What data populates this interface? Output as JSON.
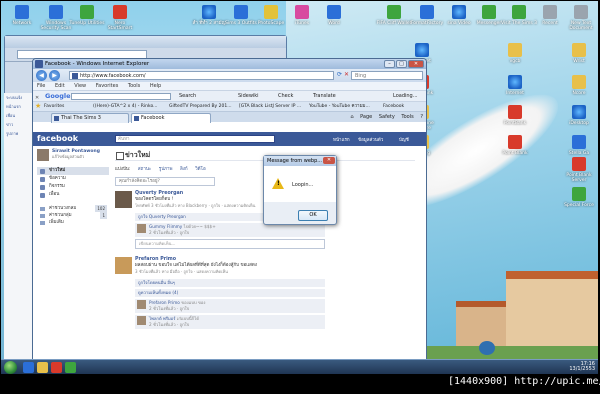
{
  "desktop": {
    "icons_top": [
      {
        "label": "Network",
        "cls": "g-blue"
      },
      {
        "label": "Windows Security Scan",
        "cls": "g-blue"
      },
      {
        "label": "TuneUp Utilities",
        "cls": "g-green"
      },
      {
        "label": "Nero StartSmart",
        "cls": "g-red"
      },
      {
        "label": "สำ ที่ทำ 2 สามัญ",
        "cls": "g-ie"
      },
      {
        "label": "Sims 3 Outfits",
        "cls": "g-blue"
      },
      {
        "label": "PhotoScape",
        "cls": "g-yel"
      },
      {
        "label": "iTunes",
        "cls": "g-pink"
      },
      {
        "label": "Word",
        "cls": "g-blue"
      },
      {
        "label": "FIFA Cliff Wallet",
        "cls": "g-green"
      },
      {
        "label": "FormatFactory",
        "cls": "g-blue"
      },
      {
        "label": "sina Video",
        "cls": "g-ie"
      },
      {
        "label": "Messenger",
        "cls": "g-green"
      },
      {
        "label": "Visit The Sims 3",
        "cls": "g-green"
      },
      {
        "label": "Recent",
        "cls": "g-gray"
      },
      {
        "label": "New Text Document",
        "cls": "g-gray"
      }
    ],
    "icons_right": [
      {
        "label": "Internet",
        "cls": "g-ie"
      },
      {
        "label": "vgcb",
        "cls": "g-fold"
      },
      {
        "label": "Wrist",
        "cls": "g-fold"
      },
      {
        "label": "PointBank",
        "cls": "g-red"
      },
      {
        "label": "Internet",
        "cls": "g-ie"
      },
      {
        "label": "Ncore",
        "cls": "g-fold"
      },
      {
        "label": "Fast Stone Capture",
        "cls": "g-fold"
      },
      {
        "label": "PointBank",
        "cls": "g-red"
      },
      {
        "label": "iDesktop",
        "cls": "g-ie"
      },
      {
        "label": "Storing",
        "cls": "g-fold"
      },
      {
        "label": "Point Blank",
        "cls": "g-red"
      },
      {
        "label": "Stella Ga",
        "cls": "g-blue"
      },
      {
        "label": "Point Blank Server",
        "cls": "g-red"
      },
      {
        "label": "Special Force",
        "cls": "g-green"
      }
    ]
  },
  "left_strip": [
    "ระบบแจ้ง",
    "หน้าแรก",
    "เพื่อน",
    "ข่าว",
    "รูปภาพ"
  ],
  "ie": {
    "title": "Facebook - Windows Internet Explorer",
    "url": "http://www.facebook.com/",
    "search_placeholder": "Bing",
    "menu": [
      "File",
      "Edit",
      "View",
      "Favorites",
      "Tools",
      "Help"
    ],
    "google_label": "Google",
    "google_items": [
      "Search",
      "Sidewiki",
      "Check",
      "Translate",
      "Loading..."
    ],
    "favorites_label": "Favorites",
    "favorites": [
      "((Here)-GTA^2 x 4) - Rinko...",
      "GiftedTV Prepared By 201...",
      "[GTA Black ListJ Server IP ...",
      "YouTube - YouTube ความม...",
      "Facebook"
    ],
    "tabs": [
      "Thai The Sims 3",
      "Facebook"
    ],
    "commands": [
      "Page",
      "Safety",
      "Tools"
    ]
  },
  "facebook": {
    "logo": "facebook",
    "search_placeholder": "ค้นหา",
    "header_links": [
      "หน้าแรก",
      "ข้อมูลส่วนตัว",
      "บัญชี"
    ],
    "profile_name": "Sirawit Pontawong",
    "profile_sub": "แก้ไขข้อมูลส่วนตัว",
    "nav": [
      {
        "label": "ข่าวใหม่",
        "selected": true
      },
      {
        "label": "ข้อความ",
        "selected": false
      },
      {
        "label": "กิจกรรม",
        "selected": false
      },
      {
        "label": "เพื่อน",
        "selected": false
      }
    ],
    "nav2": [
      {
        "label": "ค่าชวนวงกลม",
        "count": "102"
      },
      {
        "label": "ค่าชวนกลุ่ม",
        "count": "1"
      },
      {
        "label": "เพิ่มเติม",
        "count": ""
      }
    ],
    "feed_title": "ข่าวใหม่",
    "share_label": "แบ่งปัน:",
    "share_items": [
      "สถานะ",
      "รูปภาพ",
      "ลิงก์",
      "วิดีโอ"
    ],
    "status_placeholder": "คุณกำลังคิดอะไรอยู่?",
    "post1": {
      "name": "Quverty Preorgan",
      "text": "ของโคตรโดยก็ดบ !",
      "meta": "โทรศัพท์ 3 ชั่วโมงที่แล้ว ทาง Blackberry · ถูกใจ · แสดงความคิดเห็น",
      "likes": "ถูกใจ Quverty Preorgan",
      "comment_name": "Gummy Flimmy",
      "comment_text": "ไปด้วย~~ $$$+",
      "comment_meta": "2 ชั่วโมงที่แล้ว · ถูกใจ",
      "comment_input": "เขียนความคิดเห็น..."
    },
    "post2": {
      "name": "Prefaron Primo",
      "text": "ผลสอบผ่าน ขอบใจ แต่ไม่ได้ผลที่ดีที่สุด ยังไงก็ต้องสู้กับ ขอแสดง",
      "meta": "3 ชั่วโมงที่แล้ว ทาง มือถือ · ถูกใจ · แสดงความคิดเห็น",
      "likes": "ถูกใจโดยคนอื่น อื่นๆ",
      "more": "ดูความเห็นทั้งหมด (4)",
      "c1_name": "Prefaron Primo",
      "c1_text": "ของแบบ ของ",
      "c1_meta": "2 ชั่วโมงที่แล้ว · ถูกใจ",
      "c2_name": "ไพลกต์ พรีมอร์",
      "c2_text": "เก๋แบบนี้ก็ได้",
      "c2_meta": "2 ชั่วโมงที่แล้ว · ถูกใจ"
    }
  },
  "dialog": {
    "title": "Message from webp...",
    "message": "Loopin...",
    "ok": "OK"
  },
  "tray": {
    "time": "17:16",
    "date": "13/1/2553"
  },
  "watermark": "[1440x900] http://upic.me/"
}
